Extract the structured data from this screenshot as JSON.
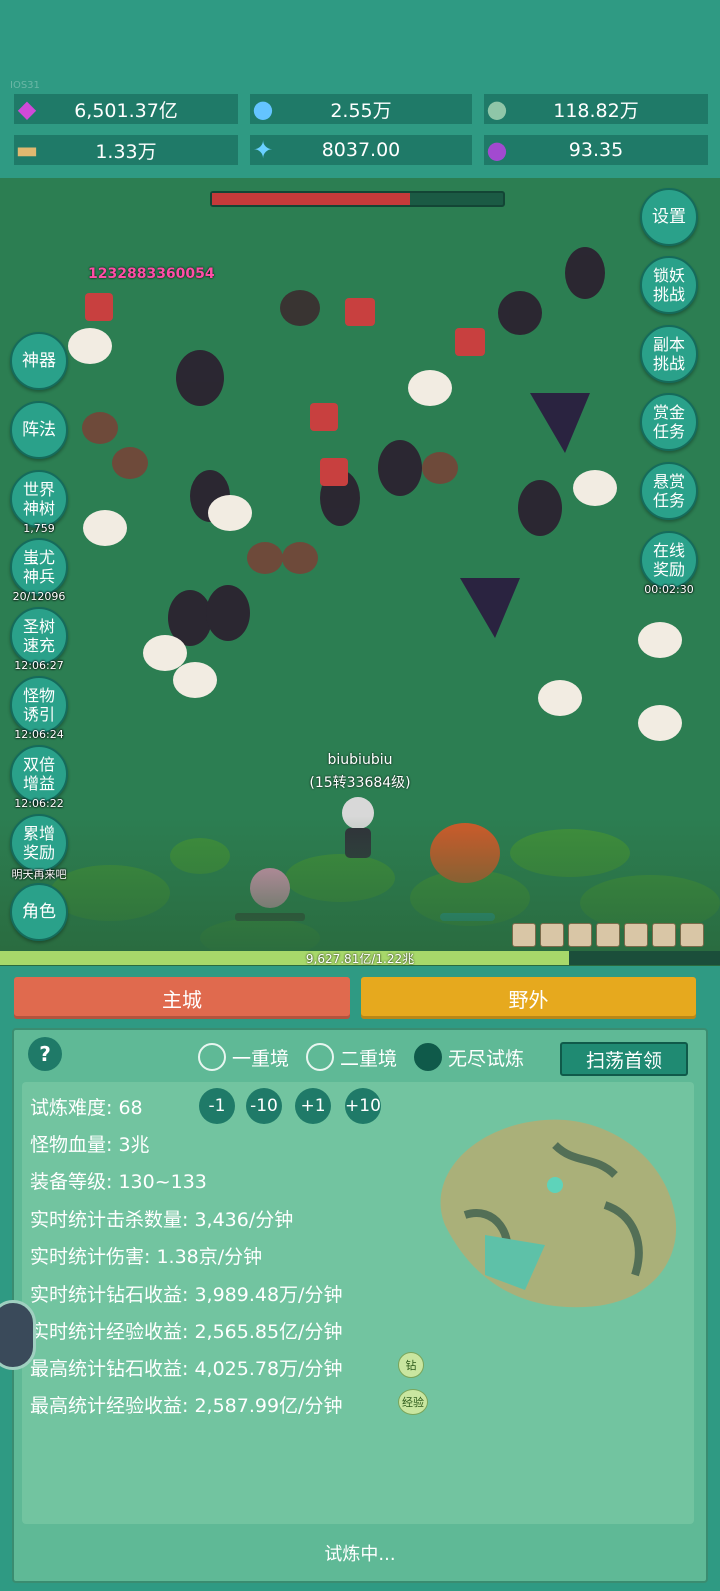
{
  "header": {
    "tag": "IOS31"
  },
  "resources": [
    {
      "icon": "purple-gem-icon",
      "value": "6,501.37亿"
    },
    {
      "icon": "blue-crystal-icon",
      "value": "2.55万"
    },
    {
      "icon": "globe-orb-icon",
      "value": "118.82万"
    },
    {
      "icon": "scroll-icon",
      "value": "1.33万"
    },
    {
      "icon": "ice-shard-icon",
      "value": "8037.00"
    },
    {
      "icon": "purple-pouch-icon",
      "value": "93.35"
    }
  ],
  "battle": {
    "boss_hp_fraction": 0.68,
    "damage_popup": "1232883360054",
    "player_name": "biubiubiu",
    "player_level": "(15转33684级)",
    "exp_text": "9,627.81亿/1.22兆",
    "exp_fraction": 0.79
  },
  "left_menu": [
    {
      "label": "神器",
      "sub": ""
    },
    {
      "label": "阵法",
      "sub": ""
    },
    {
      "label": "世界神树",
      "sub": "1,759"
    },
    {
      "label": "蚩尤神兵",
      "sub": "20/12096"
    },
    {
      "label": "圣树速充",
      "sub": "12:06:27"
    },
    {
      "label": "怪物诱引",
      "sub": "12:06:24"
    },
    {
      "label": "双倍增益",
      "sub": "12:06:22"
    },
    {
      "label": "累增奖励",
      "sub": "明天再来吧"
    },
    {
      "label": "角色",
      "sub": ""
    }
  ],
  "right_menu": [
    {
      "label": "设置",
      "sub": ""
    },
    {
      "label": "锁妖挑战",
      "sub": ""
    },
    {
      "label": "副本挑战",
      "sub": ""
    },
    {
      "label": "赏金任务",
      "sub": ""
    },
    {
      "label": "悬赏任务",
      "sub": ""
    },
    {
      "label": "在线奖励",
      "sub": "00:02:30"
    }
  ],
  "tabs": {
    "city": "主城",
    "wild": "野外"
  },
  "panel": {
    "help": "?",
    "modes": [
      "一重境",
      "二重境",
      "无尽试炼"
    ],
    "selected_mode": 2,
    "sweep_button": "扫荡首领",
    "difficulty_label": "试炼难度:",
    "difficulty_value": "68",
    "steps": [
      "-1",
      "-10",
      "+1",
      "+10"
    ],
    "stats": [
      "怪物血量: 3兆",
      "装备等级: 130~133",
      "实时统计击杀数量: 3,436/分钟",
      "实时统计伤害: 1.38京/分钟",
      "实时统计钻石收益: 3,989.48万/分钟",
      "实时统计经验收益: 2,565.85亿/分钟",
      "最高统计钻石收益: 4,025.78万/分钟",
      "最高统计经验收益: 2,587.99亿/分钟"
    ],
    "badge_diamond": "钻",
    "badge_exp": "经验",
    "status": "试炼中..."
  },
  "colors": {
    "accent": "#2f9a83",
    "city_button": "#e06a4e",
    "wild_button": "#e6a91e"
  }
}
